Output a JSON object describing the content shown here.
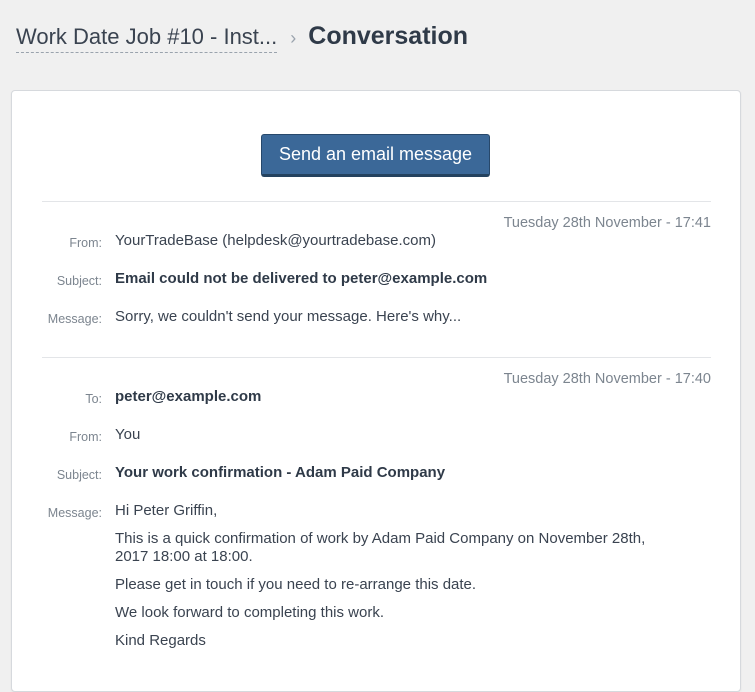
{
  "breadcrumb": {
    "parent": "Work Date Job #10 - Inst...",
    "separator": "›",
    "current": "Conversation"
  },
  "actions": {
    "send_email_label": "Send an email message"
  },
  "messages": [
    {
      "timestamp": "Tuesday 28th November - 17:41",
      "from_label": "From:",
      "from": "YourTradeBase (helpdesk@yourtradebase.com)",
      "subject_label": "Subject:",
      "subject": "Email could not be delivered to peter@example.com",
      "message_label": "Message:",
      "message": "Sorry, we couldn't send your message. Here's why..."
    },
    {
      "timestamp": "Tuesday 28th November - 17:40",
      "to_label": "To:",
      "to": "peter@example.com",
      "from_label": "From:",
      "from": "You",
      "subject_label": "Subject:",
      "subject": "Your work confirmation - Adam Paid Company",
      "message_label": "Message:",
      "message_lines": [
        "Hi Peter Griffin,",
        "This is a quick confirmation of work by Adam Paid Company on November 28th, 2017 18:00 at 18:00.",
        "Please get in touch if you need to re-arrange this date.",
        "We look forward to completing this work.",
        "Kind Regards"
      ]
    }
  ],
  "colors": {
    "button_bg": "#3b6898",
    "text": "#3a4350",
    "muted": "#7c858f",
    "page_bg": "#f0f0f0"
  }
}
